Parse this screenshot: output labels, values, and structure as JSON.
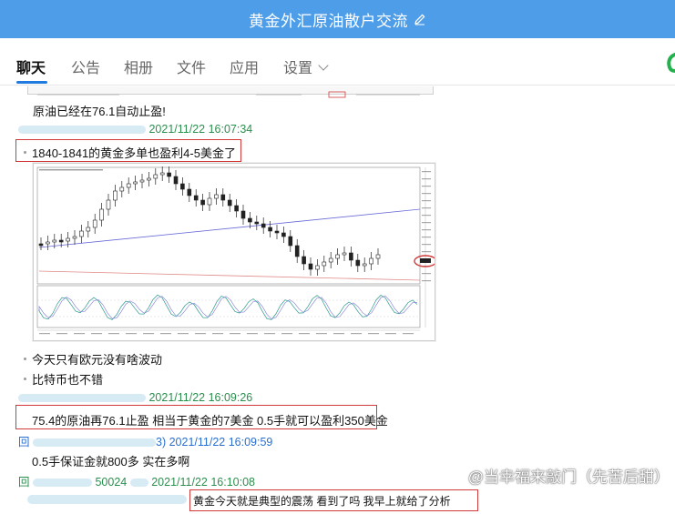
{
  "window": {
    "title": "黄金外汇原油散户交流"
  },
  "tabs": [
    {
      "label": "聊天",
      "active": true
    },
    {
      "label": "公告"
    },
    {
      "label": "相册"
    },
    {
      "label": "文件"
    },
    {
      "label": "应用"
    },
    {
      "label": "设置"
    }
  ],
  "messages": {
    "m1": "原油已经在76.1自动止盈!",
    "s1_time": "2021/11/22 16:07:34",
    "m2": "1840-1841的黄金多单也盈利4-5美金了",
    "m3": "今天只有欧元没有啥波动",
    "m4": "比特币也不错",
    "s2_time": "2021/11/22 16:09:26",
    "m5": "75.4的原油再76.1止盈 相当于黄金的7美金 0.5手就可以盈利350美金",
    "s3_prefix": "回",
    "s3_suffix": "3)",
    "s3_time": "2021/11/22 16:09:59",
    "m6": "0.5手保证金就800多 实在多啊",
    "s4_prefix": "回",
    "s4_id": "50024",
    "s4_time": "2021/11/22 16:10:08",
    "m7": "黄金今天就是典型的震荡 看到了吗 我早上就给了分析"
  },
  "watermark": "@当幸福来敲门（先苦后甜）",
  "colors": {
    "titlebar": "#4e9de8",
    "accent": "#1f7be0",
    "sender_green": "#2b8f4e",
    "sender_blue": "#2a6fd0",
    "highlight_red": "#d23a3a"
  },
  "icons": {
    "edit": "pencil-icon",
    "settings_arrow": "chevron-down-icon",
    "call": "phone-icon"
  }
}
